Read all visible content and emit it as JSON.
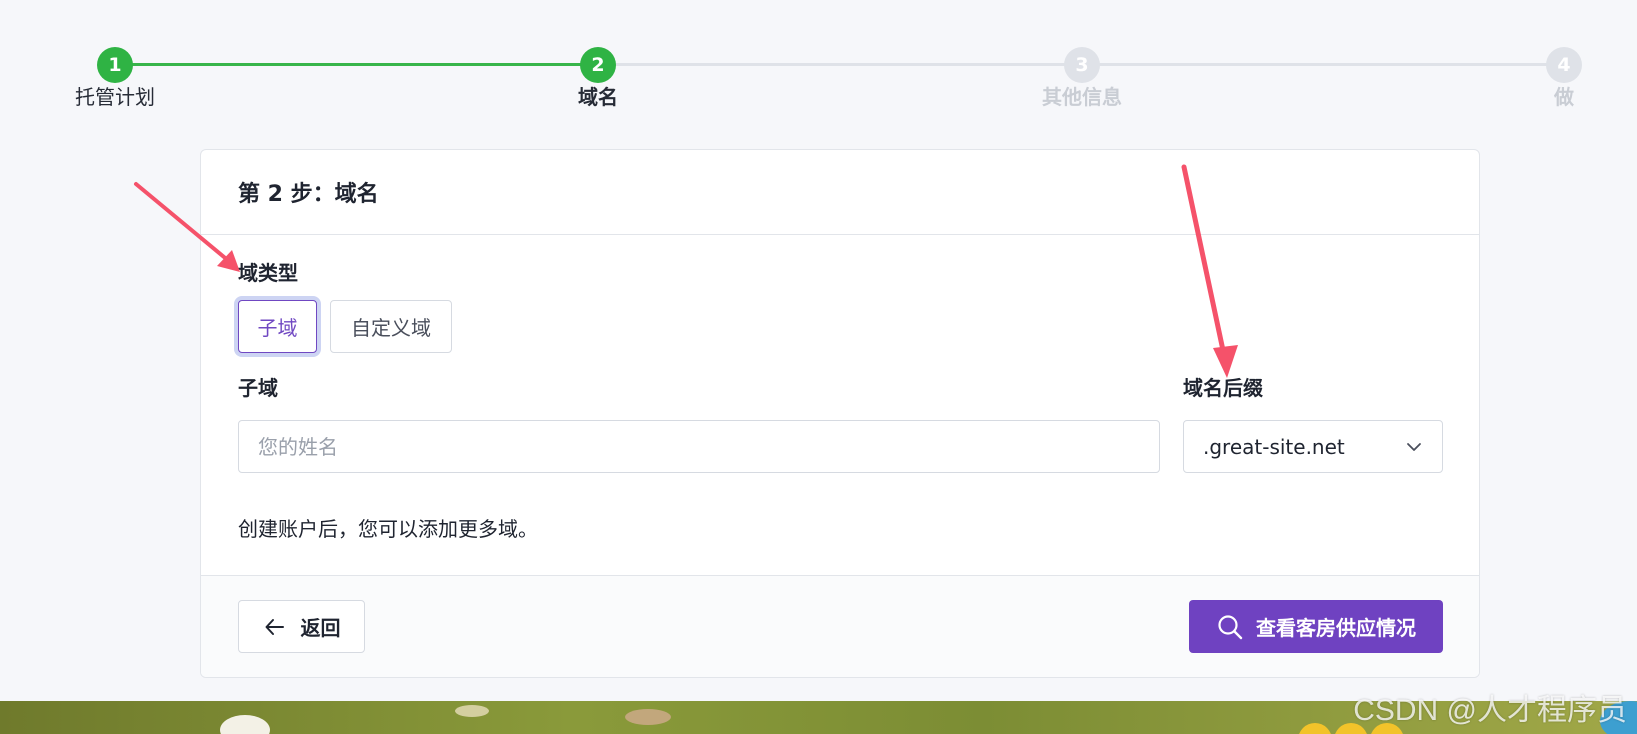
{
  "stepper": {
    "steps": [
      {
        "number": "1",
        "label": "托管计划"
      },
      {
        "number": "2",
        "label": "域名"
      },
      {
        "number": "3",
        "label": "其他信息"
      },
      {
        "number": "4",
        "label": "做"
      }
    ],
    "current_step": 2
  },
  "card": {
    "title": "第 2 步：域名",
    "domain_type": {
      "label": "域类型",
      "options": [
        "子域",
        "自定义域"
      ],
      "selected": "子域"
    },
    "subdomain": {
      "label": "子域",
      "placeholder": "您的姓名",
      "value": ""
    },
    "suffix": {
      "label": "域名后缀",
      "selected": ".great-site.net"
    },
    "help_text": "创建账户后，您可以添加更多域。",
    "footer": {
      "back_label": "返回",
      "primary_label": "查看客房供应情况"
    }
  },
  "watermark": "CSDN @人才程序员",
  "colors": {
    "step_active": "#2fb344",
    "step_inactive": "#dfe2e8",
    "accent": "#6f42c1",
    "annotation_arrow": "#f5526a"
  },
  "icons": {
    "back": "arrow-left-icon",
    "primary": "search-icon",
    "select": "chevron-down-icon"
  }
}
